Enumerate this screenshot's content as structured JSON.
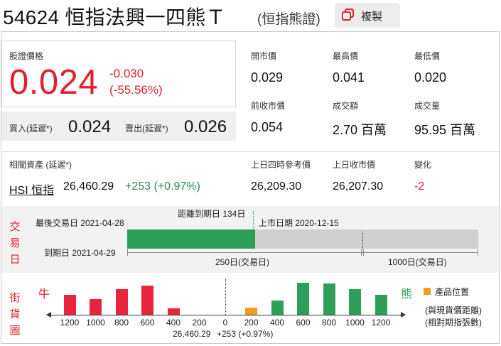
{
  "header": {
    "code_title": "54624 恒指法興一四熊Ｔ",
    "subtitle": "(恒指熊證)",
    "copy_label": "複製"
  },
  "quote": {
    "last_label": "股證價格",
    "last_price": "0.024",
    "change": "-0.030",
    "change_pct": "(-55.56%)",
    "bid_label": "買入(延遲*)",
    "bid": "0.024",
    "ask_label": "賣出(延遲*)",
    "ask": "0.026"
  },
  "stats": {
    "open_label": "開市價",
    "open": "0.029",
    "high_label": "最高價",
    "high": "0.041",
    "low_label": "最低價",
    "low": "0.020",
    "prev_close_label": "前收市價",
    "prev_close": "0.054",
    "turnover_label": "成交額",
    "turnover": "2.70 百萬",
    "volume_label": "成交量",
    "volume": "95.95 百萬"
  },
  "underlying": {
    "label": "相關資產 (延遲*)",
    "name": "HSI 恒指",
    "price": "26,460.29",
    "change": "+253 (+0.97%)",
    "ref4pm_label": "上日四時參考價",
    "ref4pm": "26,209.30",
    "prev_close_label": "上日收市價",
    "prev_close": "26,207.30",
    "diff_label": "變化",
    "diff": "-2"
  },
  "timeline": {
    "side_label": [
      "交",
      "易",
      "日"
    ],
    "last_trade": "最後交易日 2021-04-28",
    "days_to_expiry": "距離到期日 134日",
    "listing_date": "上市日期 2020-12-15",
    "expiry": "到期日 2021-04-29",
    "scale_250": "250日(交易日)",
    "scale_1000": "1000日(交易日)",
    "elapsed_fraction": 0.364,
    "colors": {
      "elapsed": "#2e9e5b",
      "remaining": "#cfcfcf"
    }
  },
  "street": {
    "side_label": [
      "街",
      "貨",
      "圖"
    ],
    "bull_label": "牛",
    "bear_label": "熊",
    "legend_label": "產品位置",
    "note_line1": "(與現貨價距離)",
    "note_line2": "(相對期指張數)",
    "center_price": "26,460.29",
    "center_change": "+253 (+0.97%)",
    "x_labels": [
      "1200",
      "1000",
      "800",
      "600",
      "400",
      "200",
      "0",
      "200",
      "400",
      "600",
      "800",
      "1000",
      "1200"
    ],
    "colors": {
      "bull": "#e8243f",
      "bear": "#2e9e5b",
      "position": "#f39c1f"
    }
  },
  "chart_data": {
    "type": "bar",
    "categories": [
      "1200",
      "1000",
      "800",
      "600",
      "400",
      "200",
      "0",
      "200",
      "400",
      "600",
      "800",
      "1000",
      "1200"
    ],
    "series": [
      {
        "name": "牛",
        "values": [
          28,
          22,
          36,
          41,
          9,
          0,
          0,
          0,
          0,
          0,
          0,
          0,
          0
        ]
      },
      {
        "name": "熊",
        "values": [
          0,
          0,
          0,
          0,
          0,
          0,
          0,
          10,
          20,
          45,
          44,
          36,
          28
        ]
      }
    ],
    "highlight_index": 7,
    "xlabel": "",
    "ylabel": "",
    "grid": false
  }
}
